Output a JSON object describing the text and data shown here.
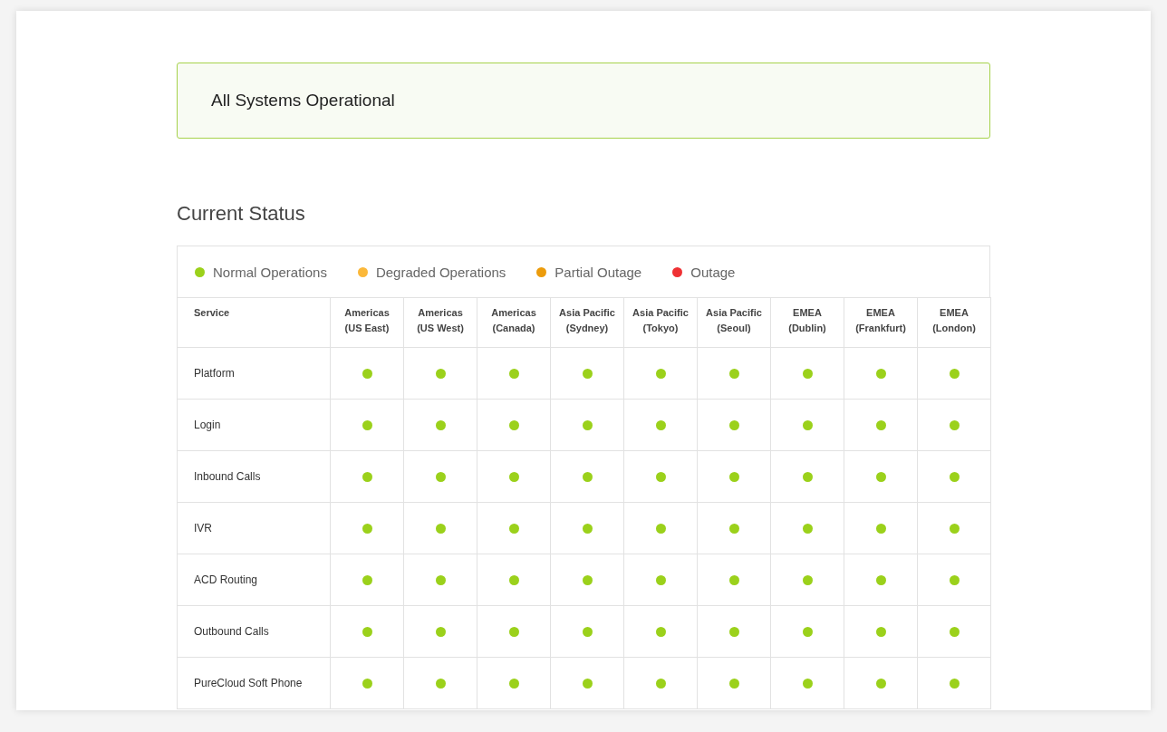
{
  "banner": {
    "text": "All Systems Operational"
  },
  "section_title": "Current Status",
  "legend": [
    {
      "label": "Normal Operations",
      "color": "#9bd11b"
    },
    {
      "label": "Degraded Operations",
      "color": "#fbb83a"
    },
    {
      "label": "Partial Outage",
      "color": "#ec9c0c"
    },
    {
      "label": "Outage",
      "color": "#ef3134"
    }
  ],
  "table": {
    "columns": [
      "Service",
      "Americas\n(US East)",
      "Americas\n(US West)",
      "Americas\n(Canada)",
      "Asia Pacific\n(Sydney)",
      "Asia Pacific\n(Tokyo)",
      "Asia Pacific\n(Seoul)",
      "EMEA\n(Dublin)",
      "EMEA\n(Frankfurt)",
      "EMEA\n(London)"
    ],
    "rows": [
      {
        "service": "Platform",
        "cells": [
          {
            "color": "#9bd11b"
          },
          {
            "color": "#9bd11b"
          },
          {
            "color": "#9bd11b"
          },
          {
            "color": "#9bd11b"
          },
          {
            "color": "#9bd11b"
          },
          {
            "color": "#9bd11b"
          },
          {
            "color": "#9bd11b"
          },
          {
            "color": "#9bd11b"
          },
          {
            "color": "#9bd11b"
          }
        ]
      },
      {
        "service": "Login",
        "cells": [
          {
            "color": "#9bd11b"
          },
          {
            "color": "#9bd11b"
          },
          {
            "color": "#9bd11b"
          },
          {
            "color": "#9bd11b"
          },
          {
            "color": "#9bd11b"
          },
          {
            "color": "#9bd11b"
          },
          {
            "color": "#9bd11b"
          },
          {
            "color": "#9bd11b"
          },
          {
            "color": "#9bd11b"
          }
        ]
      },
      {
        "service": "Inbound Calls",
        "cells": [
          {
            "color": "#9bd11b"
          },
          {
            "color": "#9bd11b"
          },
          {
            "color": "#9bd11b"
          },
          {
            "color": "#9bd11b"
          },
          {
            "color": "#9bd11b"
          },
          {
            "color": "#9bd11b"
          },
          {
            "color": "#9bd11b"
          },
          {
            "color": "#9bd11b"
          },
          {
            "color": "#9bd11b"
          }
        ]
      },
      {
        "service": "IVR",
        "cells": [
          {
            "color": "#9bd11b"
          },
          {
            "color": "#9bd11b"
          },
          {
            "color": "#9bd11b"
          },
          {
            "color": "#9bd11b"
          },
          {
            "color": "#9bd11b"
          },
          {
            "color": "#9bd11b"
          },
          {
            "color": "#9bd11b"
          },
          {
            "color": "#9bd11b"
          },
          {
            "color": "#9bd11b"
          }
        ]
      },
      {
        "service": "ACD Routing",
        "cells": [
          {
            "color": "#9bd11b"
          },
          {
            "color": "#9bd11b"
          },
          {
            "color": "#9bd11b"
          },
          {
            "color": "#9bd11b"
          },
          {
            "color": "#9bd11b"
          },
          {
            "color": "#9bd11b"
          },
          {
            "color": "#9bd11b"
          },
          {
            "color": "#9bd11b"
          },
          {
            "color": "#9bd11b"
          }
        ]
      },
      {
        "service": "Outbound Calls",
        "cells": [
          {
            "color": "#9bd11b"
          },
          {
            "color": "#9bd11b"
          },
          {
            "color": "#9bd11b"
          },
          {
            "color": "#9bd11b"
          },
          {
            "color": "#9bd11b"
          },
          {
            "color": "#9bd11b"
          },
          {
            "color": "#9bd11b"
          },
          {
            "color": "#9bd11b"
          },
          {
            "color": "#9bd11b"
          }
        ]
      },
      {
        "service": "PureCloud Soft Phone",
        "cells": [
          {
            "color": "#9bd11b"
          },
          {
            "color": "#9bd11b"
          },
          {
            "color": "#9bd11b"
          },
          {
            "color": "#9bd11b"
          },
          {
            "color": "#9bd11b"
          },
          {
            "color": "#9bd11b"
          },
          {
            "color": "#9bd11b"
          },
          {
            "color": "#9bd11b"
          },
          {
            "color": "#9bd11b"
          }
        ]
      }
    ]
  }
}
